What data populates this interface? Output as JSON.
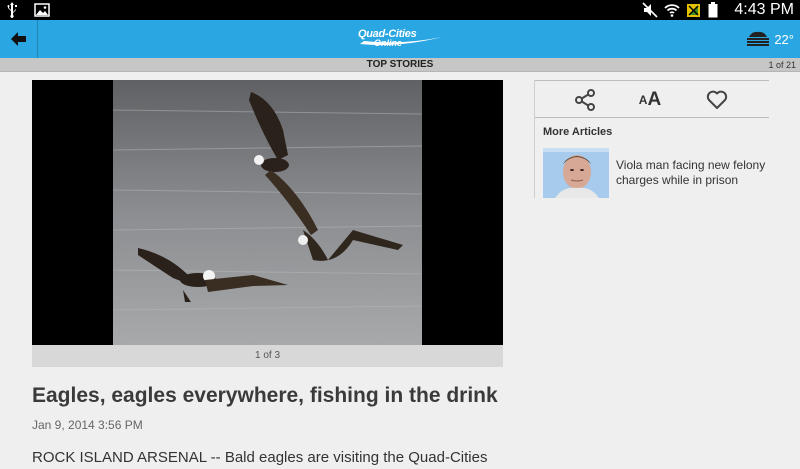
{
  "status_bar": {
    "time": "4:43 PM",
    "icons": [
      "usb-icon",
      "image-notification-icon",
      "mute-icon",
      "wifi-icon",
      "signal-icon",
      "battery-icon"
    ]
  },
  "action_bar": {
    "logo_line1": "Quad-Cities",
    "logo_line2": "Online",
    "weather_temp": "22°",
    "colors": {
      "bar": "#2aa6e3"
    }
  },
  "section": {
    "title": "TOP STORIES",
    "count": "1 of 21"
  },
  "article": {
    "media_caption": "1 of 3",
    "headline": "Eagles, eagles everywhere, fishing in the drink",
    "date": "Jan 9, 2014 3:56 PM",
    "body_start": "ROCK ISLAND ARSENAL -- Bald eagles are visiting the Quad-Cities"
  },
  "tools": {
    "font_small": "A",
    "font_big": "A"
  },
  "more_articles": {
    "title": "More Articles",
    "items": [
      {
        "title": "Viola man facing new felony charges while in prison"
      }
    ]
  }
}
